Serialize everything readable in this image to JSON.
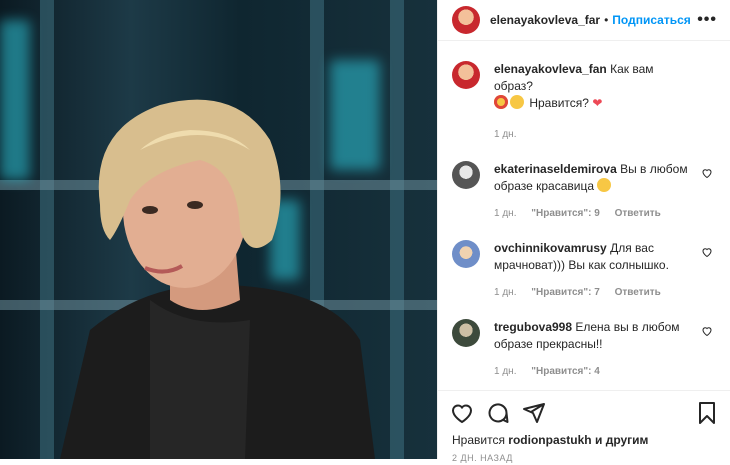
{
  "post": {
    "author": "elenayakovleva_far",
    "follow_label": "Подписаться",
    "more_label": "•••"
  },
  "caption": {
    "author": "elenayakovleva_fan",
    "text_before": "Как вам образ?",
    "text_after": "Нравится?",
    "time": "1 дн."
  },
  "comments": [
    {
      "author": "ekaterinaseldemirova",
      "text": "Вы в любом образе красавица",
      "time": "1 дн.",
      "likes": "\"Нравится\": 9",
      "reply": "Ответить"
    },
    {
      "author": "ovchinnikovamrusy",
      "text": "Для вас мрачноват))) Вы как солнышко.",
      "time": "1 дн.",
      "likes": "\"Нравится\": 7",
      "reply": "Ответить"
    },
    {
      "author": "tregubova998",
      "text": "Елена вы в любом образе прекрасны!!",
      "time": "1 дн.",
      "likes": "\"Нравится\": 4",
      "reply": ""
    }
  ],
  "likes_line": {
    "prefix": "Нравится",
    "user": "rodionpastukh",
    "suffix": "и другим"
  },
  "footer_time": "2 ДН. НАЗАД",
  "colors": {
    "accent": "#0095f6",
    "heart_red": "#ed4956",
    "muted": "#8e8e8e"
  }
}
